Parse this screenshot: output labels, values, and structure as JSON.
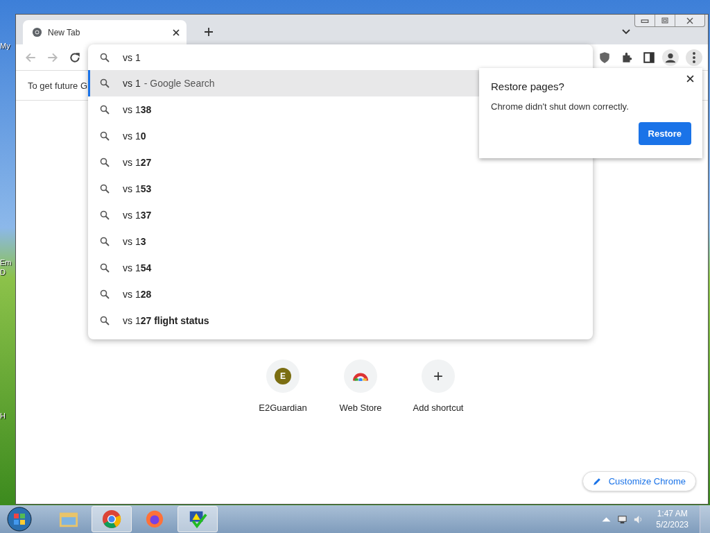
{
  "desktop": {
    "icon_labels": [
      "My",
      "Em",
      "D",
      "H"
    ]
  },
  "browser": {
    "tab": {
      "title": "New Tab",
      "selected": true
    },
    "omnibox": {
      "value": "vs 1"
    },
    "suggestions": [
      {
        "text": "vs 1",
        "hint": "- Google Search",
        "selected": true
      },
      {
        "text": "vs 1**38**",
        "selected": false
      },
      {
        "text": "vs 1**0**",
        "selected": false
      },
      {
        "text": "vs 1**27**",
        "selected": false
      },
      {
        "text": "vs 1**53**",
        "selected": false
      },
      {
        "text": "vs 1**37**",
        "selected": false
      },
      {
        "text": "vs 1**3**",
        "selected": false
      },
      {
        "text": "vs 1**54**",
        "selected": false
      },
      {
        "text": "vs 1**28**",
        "selected": false
      },
      {
        "text": "vs 1**27 flight status**",
        "selected": false
      }
    ],
    "infobar": {
      "text": "To get future G"
    },
    "restore_popup": {
      "title": "Restore pages?",
      "message": "Chrome didn't shut down correctly.",
      "button": "Restore"
    },
    "shortcuts": [
      {
        "kind": "letter",
        "letter": "E",
        "label": "E2Guardian"
      },
      {
        "kind": "store",
        "label": "Web Store"
      },
      {
        "kind": "add",
        "symbol": "+",
        "label": "Add shortcut"
      }
    ],
    "customize_button": "Customize Chrome"
  },
  "taskbar": {
    "apps": [
      {
        "kind": "explorer",
        "selected": false
      },
      {
        "kind": "chrome",
        "selected": true
      },
      {
        "kind": "firefox",
        "selected": false
      },
      {
        "kind": "alert",
        "selected": true
      }
    ],
    "time": "1:47 AM",
    "date": "5/2/2023"
  }
}
